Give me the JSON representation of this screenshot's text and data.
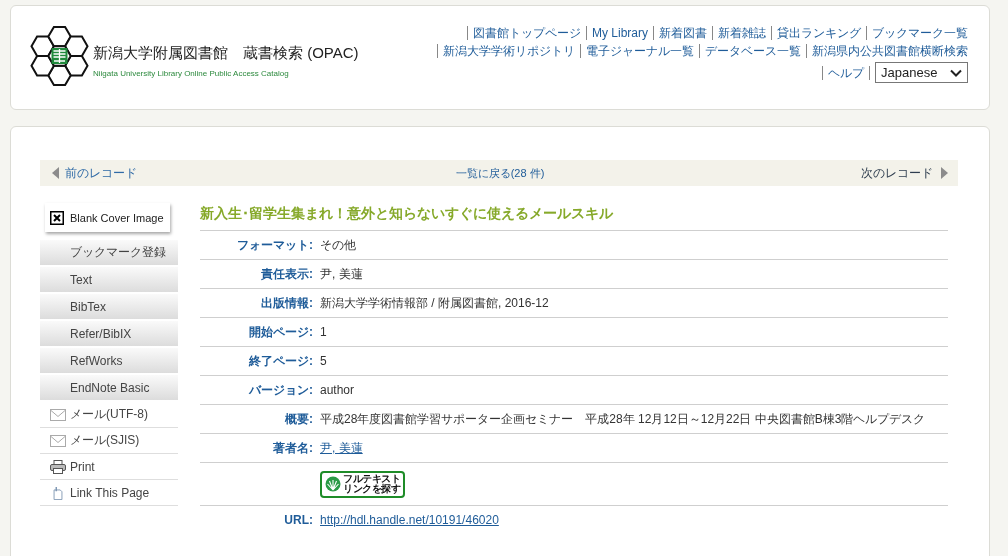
{
  "header": {
    "title": "新潟大学附属図書館　蔵書検索 (OPAC)",
    "subtitle": "Niigata University Library Online Public Access Catalog",
    "nav_rows": [
      [
        "図書館トップページ",
        "My Library",
        "新着図書",
        "新着雑誌",
        "貸出ランキング",
        "ブックマーク一覧"
      ],
      [
        "新潟大学学術リポジトリ",
        "電子ジャーナル一覧",
        "データベース一覧",
        "新潟県内公共図書館横断検索"
      ],
      [
        "ヘルプ"
      ]
    ],
    "language_select": {
      "value": "Japanese"
    }
  },
  "record_nav": {
    "previous": "前のレコード",
    "back_to_list": "一覧に戻る(28 件)",
    "next": "次のレコード"
  },
  "sidebar": {
    "cover_placeholder": "Blank Cover Image",
    "buttons": [
      "ブックマーク登録",
      "Text",
      "BibTex",
      "Refer/BibIX",
      "RefWorks",
      "EndNote Basic"
    ],
    "links": [
      {
        "kind": "mail",
        "label": "メール(UTF-8)"
      },
      {
        "kind": "mail",
        "label": "メール(SJIS)"
      },
      {
        "kind": "print",
        "label": "Print"
      },
      {
        "kind": "page",
        "label": "Link This Page"
      }
    ]
  },
  "record": {
    "title": "新入生･留学生集まれ！意外と知らないすぐに使えるメールスキル",
    "fields": [
      {
        "kind": "text",
        "label": "フォーマット:",
        "value": "その他"
      },
      {
        "kind": "text",
        "label": "責任表示:",
        "value": "尹, 美蓮"
      },
      {
        "kind": "text",
        "label": "出版情報:",
        "value": "新潟大学学術情報部 / 附属図書館, 2016-12"
      },
      {
        "kind": "text",
        "label": "開始ページ:",
        "value": "1"
      },
      {
        "kind": "text",
        "label": "終了ページ:",
        "value": "5"
      },
      {
        "kind": "text",
        "label": "バージョン:",
        "value": "author"
      },
      {
        "kind": "text",
        "label": "概要:",
        "value": "平成28年度図書館学習サポーター企画セミナー　平成28年 12月12日～12月22日 中央図書館B棟3階ヘルプデスク"
      },
      {
        "kind": "link",
        "label": "著者名:",
        "value": "尹, 美蓮"
      },
      {
        "kind": "button",
        "lines": [
          "フルテキスト",
          "リンクを探す"
        ]
      },
      {
        "kind": "link",
        "label": "URL:",
        "value": "http://hdl.handle.net/10191/46020"
      }
    ]
  }
}
